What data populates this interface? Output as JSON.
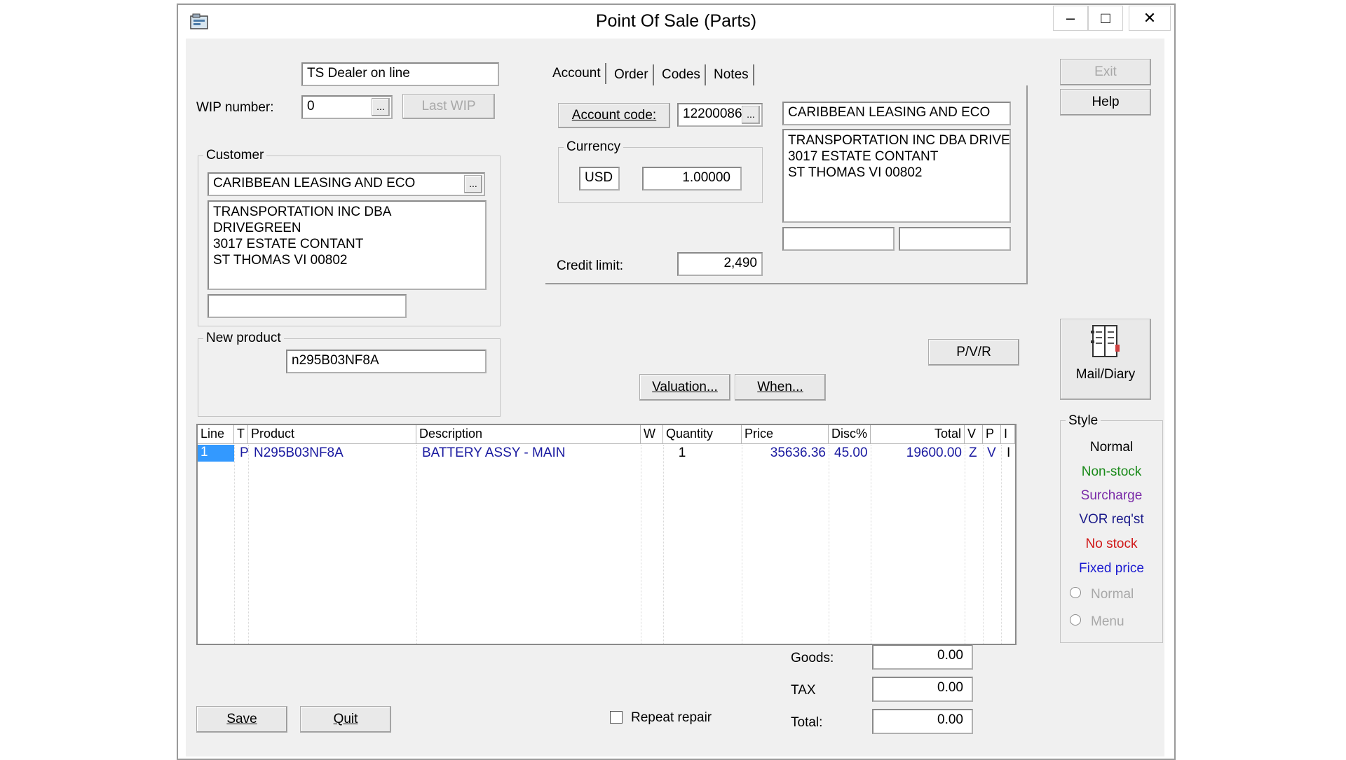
{
  "window": {
    "title": "Point Of Sale (Parts)",
    "controls": {
      "minimize": "–",
      "maximize": "□",
      "close": "✕"
    }
  },
  "header": {
    "dealer_field": "TS   Dealer on line",
    "wip_label": "WIP number:",
    "wip_value": "0",
    "wip_lookup": "...",
    "last_wip": "Last WIP"
  },
  "customer": {
    "group_label": "Customer",
    "name": "CARIBBEAN LEASING AND ECO",
    "lookup": "...",
    "address": [
      "TRANSPORTATION INC DBA DRIVEGREEN",
      "3017 ESTATE CONTANT",
      "ST THOMAS VI 00802"
    ],
    "extra": ""
  },
  "new_product": {
    "group_label": "New product",
    "value": "n295B03NF8A"
  },
  "tabs": [
    "Account",
    "Order",
    "Codes",
    "Notes"
  ],
  "account": {
    "code_button": "Account code:",
    "code_value": "12200086",
    "code_lookup": "...",
    "currency_label": "Currency",
    "currency_code": "USD",
    "currency_rate": "1.00000",
    "credit_label": "Credit limit:",
    "credit_value": "2,490",
    "name": "CARIBBEAN LEASING AND ECO",
    "address": [
      "TRANSPORTATION INC DBA DRIVE",
      "3017 ESTATE CONTANT",
      "ST THOMAS VI 00802"
    ]
  },
  "side": {
    "exit": "Exit",
    "help": "Help",
    "mail_diary": "Mail/Diary",
    "pvr": "P/V/R"
  },
  "actions": {
    "valuation": "Valuation...",
    "when": "When..."
  },
  "grid": {
    "columns": [
      "Line",
      "T",
      "Product",
      "Description",
      "W",
      "Quantity",
      "Price",
      "Disc%",
      "Total",
      "V",
      "P",
      "I"
    ],
    "rows": [
      {
        "line": "1",
        "t": "P",
        "product": "N295B03NF8A",
        "description": "BATTERY ASSY - MAIN",
        "w": "",
        "quantity": "1",
        "price": "35636.36",
        "disc": "45.00",
        "total": "19600.00",
        "v": "Z",
        "p": "V",
        "i": "I"
      }
    ]
  },
  "style": {
    "label": "Style",
    "items": [
      {
        "label": "Normal",
        "color": "#000000"
      },
      {
        "label": "Non-stock",
        "color": "#1a8a1a"
      },
      {
        "label": "Surcharge",
        "color": "#7a2aa8"
      },
      {
        "label": "VOR req'st",
        "color": "#1a1a8a"
      },
      {
        "label": "No stock",
        "color": "#d01818"
      },
      {
        "label": "Fixed price",
        "color": "#1a1ad0"
      }
    ],
    "radio_normal": "Normal",
    "radio_menu": "Menu"
  },
  "totals": {
    "goods_label": "Goods:",
    "goods": "0.00",
    "tax_label": "TAX",
    "tax": "0.00",
    "total_label": "Total:",
    "total": "0.00"
  },
  "footer": {
    "save": "Save",
    "quit": "Quit",
    "repeat_repair": "Repeat repair"
  }
}
